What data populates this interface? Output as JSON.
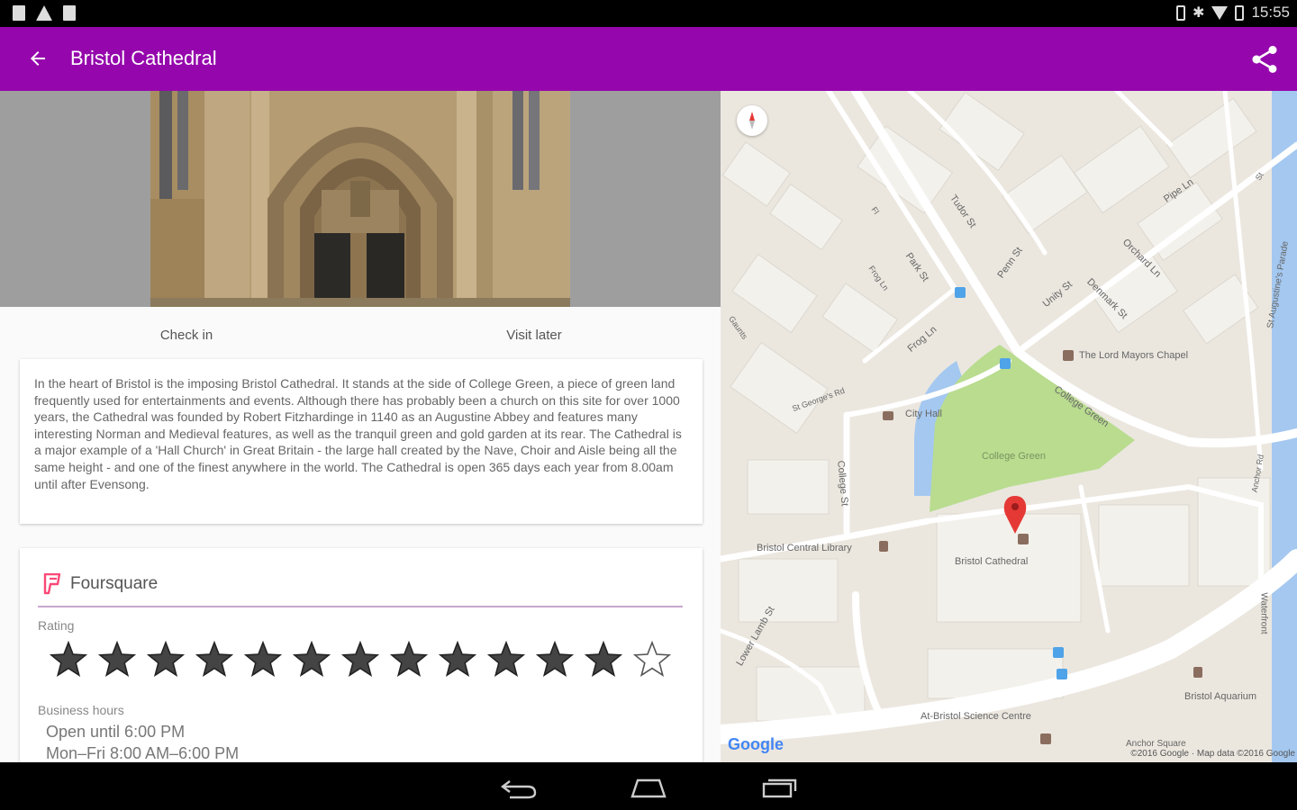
{
  "status_bar": {
    "time": "15:55"
  },
  "app_bar": {
    "title": "Bristol Cathedral"
  },
  "actions": {
    "check_in": "Check in",
    "visit_later": "Visit later"
  },
  "description": "In the heart of Bristol is the imposing Bristol Cathedral. It stands at the side of College Green, a piece of green land frequently used for entertainments and events. Although there has probably been a church on this site for over 1000 years, the Cathedral was founded by Robert Fitzhardinge in 1140 as an Augustine Abbey and features many interesting Norman and Medieval features, as well as the tranquil green and gold garden at its rear. The Cathedral is a major example of a 'Hall Church' in Great Britain - the large hall created by the Nave, Choir and Aisle being all the same height - and one of the finest anywhere in the world. The Cathedral is open 365 days each year from 8.00am until after Evensong.",
  "foursquare": {
    "title": "Foursquare",
    "rating_label": "Rating",
    "rating": {
      "filled": 12,
      "total": 13
    },
    "business_hours_label": "Business hours",
    "hours_line1": "Open until 6:00 PM",
    "hours_line2": "Mon–Fri 8:00 AM–6:00 PM"
  },
  "map": {
    "labels": {
      "lord_mayors_chapel": "The Lord Mayors Chapel",
      "city_hall": "City Hall",
      "college_green": "College Green",
      "central_library": "Bristol Central Library",
      "cathedral": "Bristol Cathedral",
      "science_centre": "At-Bristol Science Centre",
      "aquarium": "Bristol Aquarium",
      "anchor_square": "Anchor Square",
      "park_st": "Park St",
      "frog_ln": "Frog Ln",
      "orchard_ln": "Orchard Ln",
      "denmark_st": "Denmark St",
      "unity_st": "Unity St",
      "pipe_ln": "Pipe Ln",
      "college_st": "College St",
      "lower_lamb_st": "Lower Lamb St",
      "college_green_rd": "College Green",
      "st_georges_rd": "St George's Rd",
      "tudor_st": "Tudor St",
      "fl": "Fl",
      "penn_st": "Penn St",
      "st_augustines_parade": "St Augustine's Parade",
      "waterfront": "Waterfront",
      "anchor_rd": "Anchor Rd",
      "frog_ln2": "Frog Ln",
      "st_st": "St",
      "gaunts": "Gaunts"
    },
    "google": "Google",
    "credit": "©2016 Google · Map data ©2016 Google"
  },
  "colors": {
    "app_bar": "#9507ac",
    "map_pin": "#e53935",
    "park": "#b9dc8f",
    "water": "#a4c8f0"
  }
}
